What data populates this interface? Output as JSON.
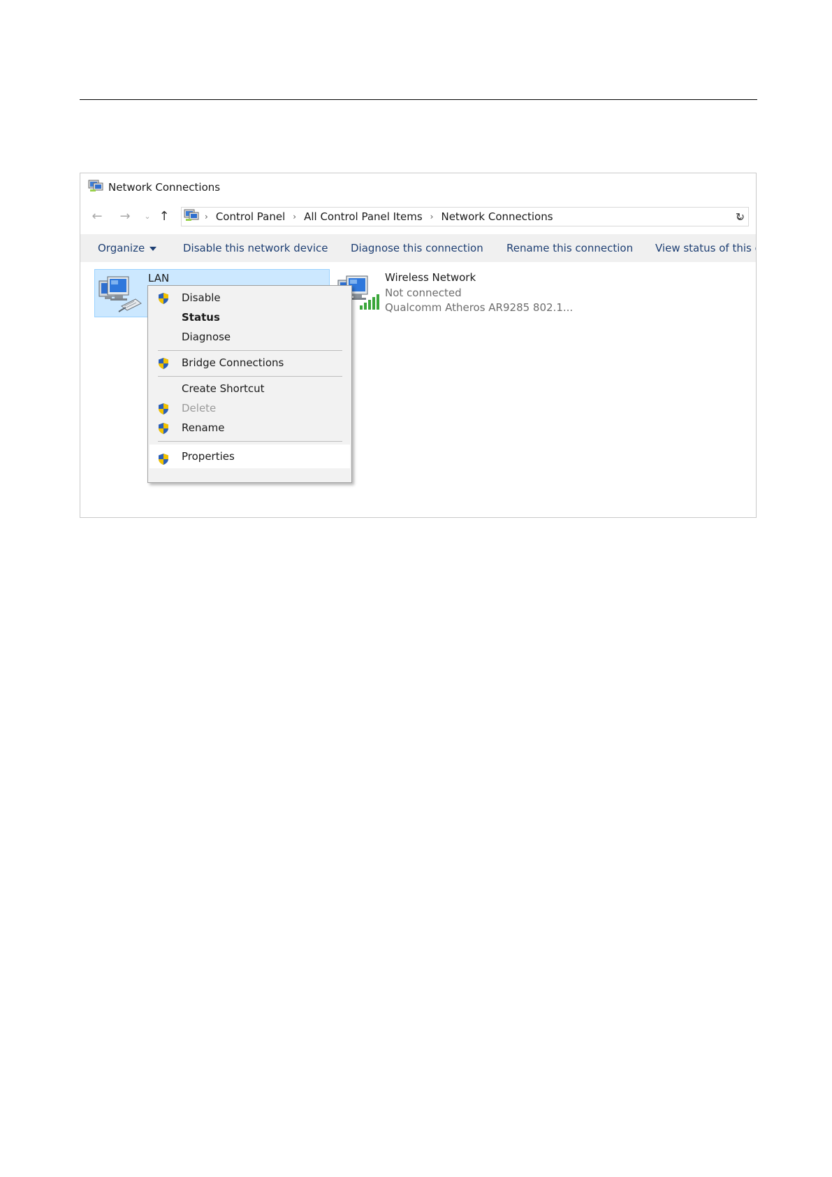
{
  "window": {
    "title": "Network Connections"
  },
  "address": {
    "crumbs": [
      "Control Panel",
      "All Control Panel Items",
      "Network Connections"
    ],
    "separator": "›"
  },
  "nav": {
    "back_glyph": "←",
    "forward_glyph": "→",
    "recent_glyph": "⌄",
    "up_glyph": "↑",
    "dropdown_glyph": "⌄",
    "refresh_glyph": "↻"
  },
  "commands": {
    "organize": "Organize",
    "disable_device": "Disable this network device",
    "diagnose": "Diagnose this connection",
    "rename": "Rename this connection",
    "view_status": "View status of this connection"
  },
  "connections": {
    "lan": {
      "name": "LAN",
      "icon": "network-adapter-wired-icon"
    },
    "wifi": {
      "name": "Wireless Network",
      "status": "Not connected",
      "device": "Qualcomm Atheros AR9285 802.1...",
      "icon": "network-adapter-wireless-icon"
    }
  },
  "context_menu": {
    "items": [
      {
        "label": "Disable",
        "shield": true
      },
      {
        "label": "Status",
        "bold": true
      },
      {
        "label": "Diagnose"
      },
      {
        "label": "Bridge Connections",
        "shield": true
      },
      {
        "label": "Create Shortcut"
      },
      {
        "label": "Delete",
        "shield": true,
        "disabled": true
      },
      {
        "label": "Rename",
        "shield": true
      },
      {
        "label": "Properties",
        "shield": true,
        "highlighted": true
      }
    ]
  },
  "colors": {
    "selection_bg": "#cce8ff",
    "selection_border": "#99d1ff",
    "command_text": "#1e3f73",
    "command_bar_bg": "#f0f0f0",
    "menu_bg": "#f2f2f2",
    "shield_blue": "#2b5fb7",
    "shield_yellow": "#f2c200",
    "signal_green": "#3aa63a"
  }
}
